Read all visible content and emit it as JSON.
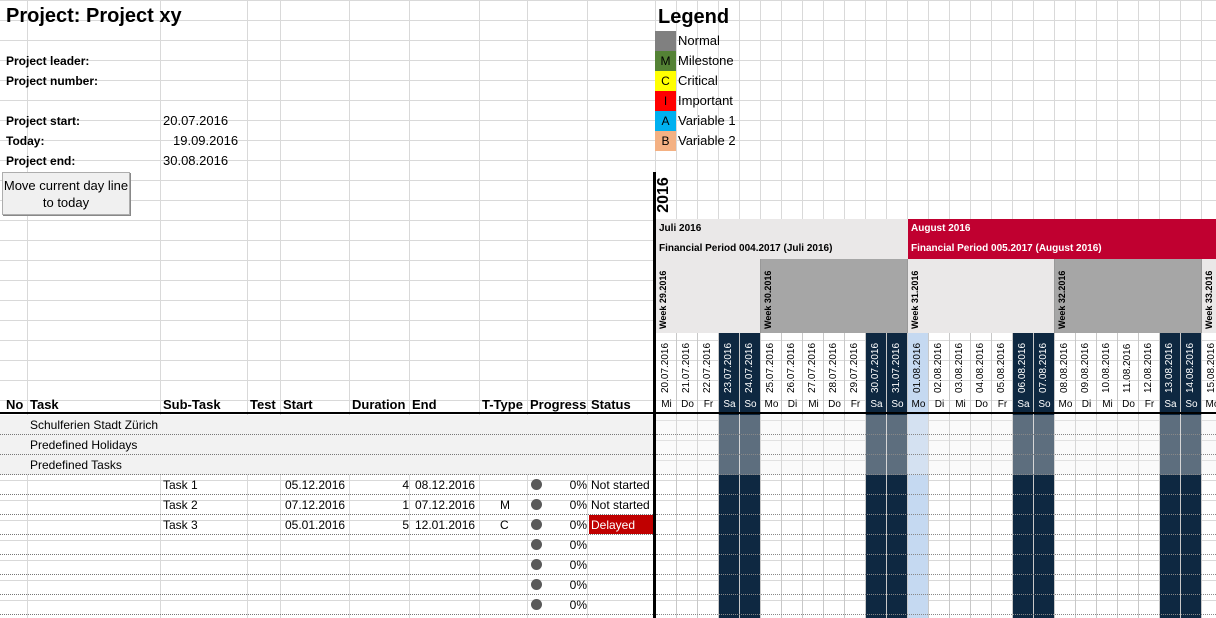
{
  "project": {
    "title": "Project: Project xy",
    "leader_label": "Project leader:",
    "number_label": "Project number:",
    "start_label": "Project start:",
    "start_value": "20.07.2016",
    "today_label": "Today:",
    "today_value": "19.09.2016",
    "end_label": "Project end:",
    "end_value": "30.08.2016"
  },
  "button": {
    "move_today": "Move current day line to today"
  },
  "legend": {
    "title": "Legend",
    "items": [
      {
        "code": "",
        "label": "Normal",
        "color": "#808080"
      },
      {
        "code": "M",
        "label": "Milestone",
        "color": "#548235"
      },
      {
        "code": "C",
        "label": "Critical",
        "color": "#ffff00"
      },
      {
        "code": "I",
        "label": "Important",
        "color": "#ff0000"
      },
      {
        "code": "A",
        "label": "Variable 1",
        "color": "#00b0f0"
      },
      {
        "code": "B",
        "label": "Variable 2",
        "color": "#f4b183"
      }
    ]
  },
  "timeline": {
    "year": "2016",
    "months": [
      {
        "name": "Juli 2016",
        "period": "Financial Period 004.2017 (Juli 2016)",
        "color": "#eae8e8"
      },
      {
        "name": "August 2016",
        "period": "Financial Period 005.2017 (August 2016)",
        "color": "#c00030"
      }
    ],
    "weeks": [
      "Week 29.2016",
      "Week 30.2016",
      "Week 31.2016",
      "Week 32.2016",
      "Week 33.2016"
    ],
    "days": [
      {
        "date": "20.07.2016",
        "name": "Mi"
      },
      {
        "date": "21.07.2016",
        "name": "Do"
      },
      {
        "date": "22.07.2016",
        "name": "Fr"
      },
      {
        "date": "23.07.2016",
        "name": "Sa"
      },
      {
        "date": "24.07.2016",
        "name": "So"
      },
      {
        "date": "25.07.2016",
        "name": "Mo"
      },
      {
        "date": "26.07.2016",
        "name": "Di"
      },
      {
        "date": "27.07.2016",
        "name": "Mi"
      },
      {
        "date": "28.07.2016",
        "name": "Do"
      },
      {
        "date": "29.07.2016",
        "name": "Fr"
      },
      {
        "date": "30.07.2016",
        "name": "Sa"
      },
      {
        "date": "31.07.2016",
        "name": "So"
      },
      {
        "date": "01.08.2016",
        "name": "Mo"
      },
      {
        "date": "02.08.2016",
        "name": "Di"
      },
      {
        "date": "03.08.2016",
        "name": "Mi"
      },
      {
        "date": "04.08.2016",
        "name": "Do"
      },
      {
        "date": "05.08.2016",
        "name": "Fr"
      },
      {
        "date": "06.08.2016",
        "name": "Sa"
      },
      {
        "date": "07.08.2016",
        "name": "So"
      },
      {
        "date": "08.08.2016",
        "name": "Mo"
      },
      {
        "date": "09.08.2016",
        "name": "Di"
      },
      {
        "date": "10.08.2016",
        "name": "Mi"
      },
      {
        "date": "11.08.2016",
        "name": "Do"
      },
      {
        "date": "12.08.2016",
        "name": "Fr"
      },
      {
        "date": "13.08.2016",
        "name": "Sa"
      },
      {
        "date": "14.08.2016",
        "name": "So"
      },
      {
        "date": "15.08.2016",
        "name": "Mo"
      }
    ],
    "weekend_color": "#0e2841",
    "today_color": "#c5d9f1"
  },
  "columns": {
    "no": "No",
    "task": "Task",
    "subtask": "Sub-Task",
    "test": "Test",
    "start": "Start",
    "duration": "Duration",
    "end": "End",
    "ttype": "T-Type",
    "progress": "Progress",
    "status": "Status"
  },
  "rows": [
    {
      "task": "Schulferien Stadt Zürich",
      "grey": true
    },
    {
      "task": "Predefined Holidays",
      "grey": true
    },
    {
      "task": "Predefined Tasks",
      "grey": true
    },
    {
      "subtask": "Task 1",
      "start": "05.12.2016",
      "duration": "4",
      "end": "08.12.2016",
      "ttype": "",
      "progress": "0%",
      "status": "Not started"
    },
    {
      "subtask": "Task 2",
      "start": "07.12.2016",
      "duration": "1",
      "end": "07.12.2016",
      "ttype": "M",
      "progress": "0%",
      "status": "Not started"
    },
    {
      "subtask": "Task 3",
      "start": "05.01.2016",
      "duration": "5",
      "end": "12.01.2016",
      "ttype": "C",
      "progress": "0%",
      "status": "Delayed"
    },
    {
      "progress": "0%"
    },
    {
      "progress": "0%"
    },
    {
      "progress": "0%"
    },
    {
      "progress": "0%"
    }
  ]
}
